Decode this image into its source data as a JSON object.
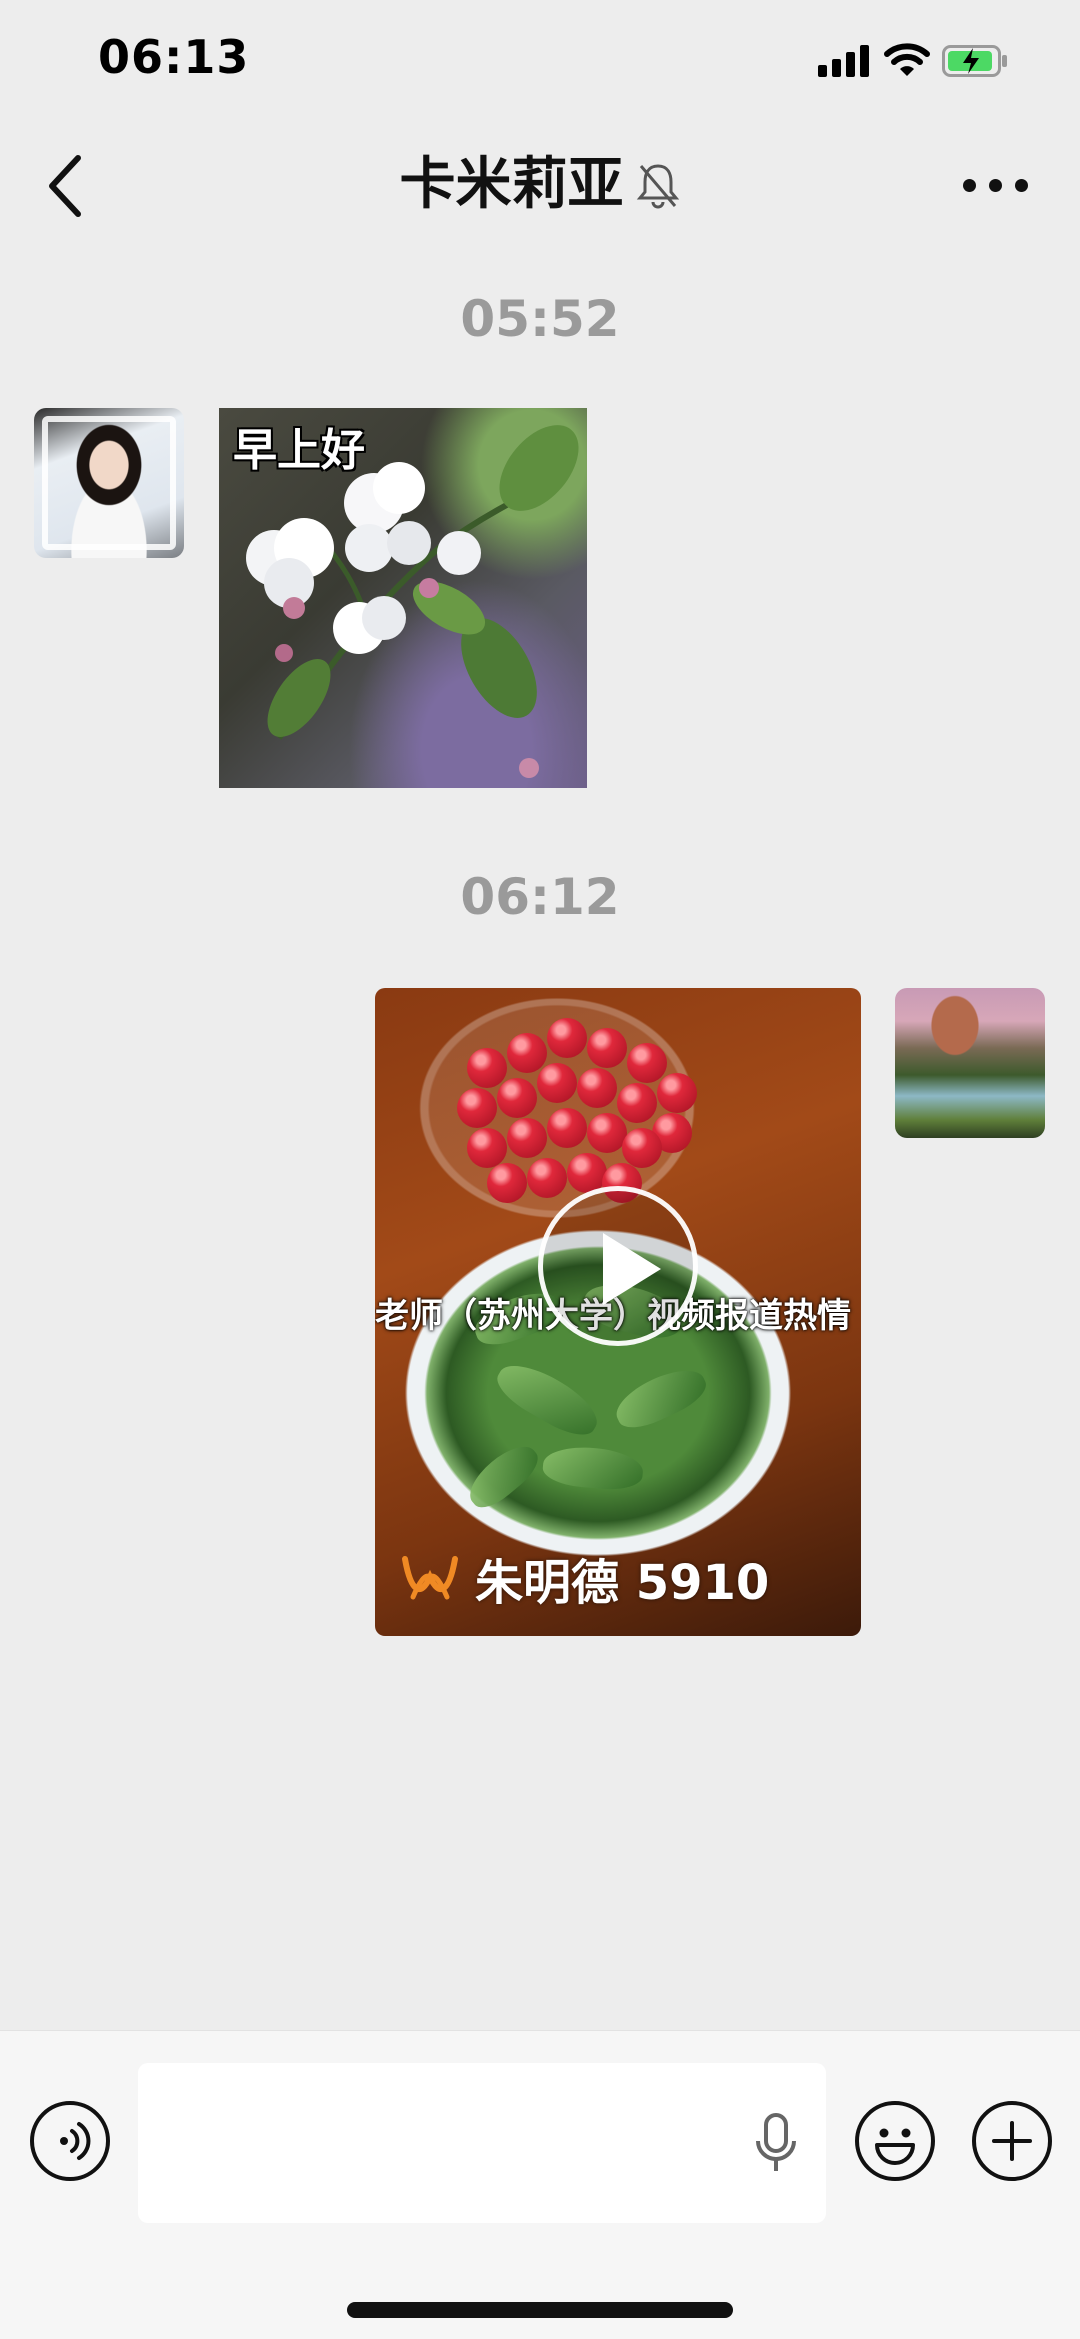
{
  "status_bar": {
    "time": "06:13"
  },
  "header": {
    "title": "卡米莉亚"
  },
  "messages": [
    {
      "timestamp": "05:52",
      "sender": "left",
      "type": "image",
      "caption": "早上好"
    },
    {
      "timestamp": "06:12",
      "sender": "right",
      "type": "video",
      "overlay_text": "老师（苏州大学）视频报道热情",
      "watermark": "朱明德 5910"
    }
  ],
  "input_bar": {
    "value": "",
    "placeholder": ""
  },
  "colors": {
    "background": "#ededed",
    "input_bar": "#f6f6f6",
    "timestamp": "#9a9a9a",
    "watermark_logo": "#f08a24"
  }
}
